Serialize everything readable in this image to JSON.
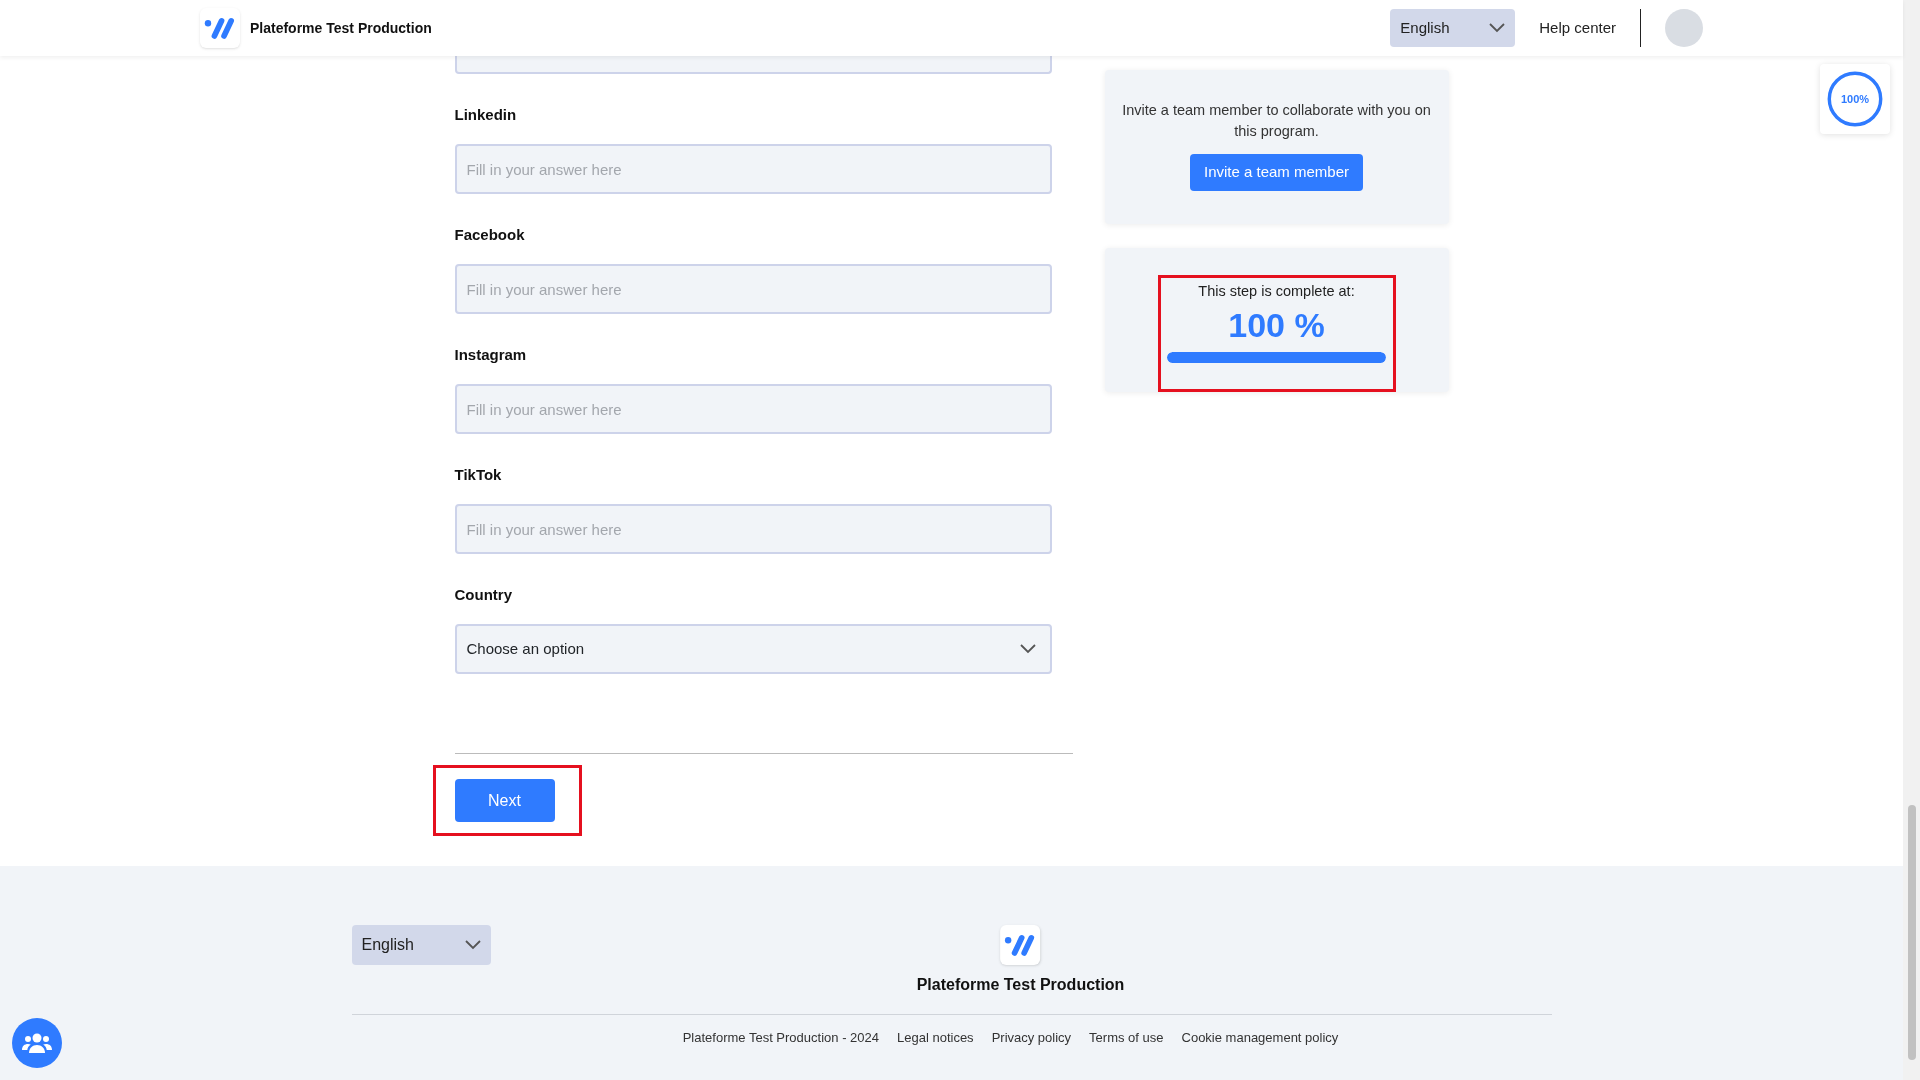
{
  "header": {
    "brand": "Plateforme Test Production",
    "language": "English",
    "help": "Help center"
  },
  "form": {
    "fields": [
      {
        "kind": "text",
        "label": "Linkedin",
        "placeholder": "Fill in your answer here"
      },
      {
        "kind": "text",
        "label": "Facebook",
        "placeholder": "Fill in your answer here"
      },
      {
        "kind": "text",
        "label": "Instagram",
        "placeholder": "Fill in your answer here"
      },
      {
        "kind": "text",
        "label": "TikTok",
        "placeholder": "Fill in your answer here"
      },
      {
        "kind": "select",
        "label": "Country",
        "value": "Choose an option"
      }
    ],
    "next": "Next"
  },
  "invite": {
    "text": "Invite a team member to collaborate with you on this program.",
    "button": "Invite a team member"
  },
  "progress": {
    "caption": "This step is complete at:",
    "value": "100 %",
    "level": 1
  },
  "progress_badge": {
    "text": "100%",
    "level": 1
  },
  "footer": {
    "language": "English",
    "brand": "Plateforme Test Production",
    "links": [
      "Plateforme Test Production - 2024",
      "Legal notices",
      "Privacy policy",
      "Terms of use",
      "Cookie management policy"
    ]
  }
}
